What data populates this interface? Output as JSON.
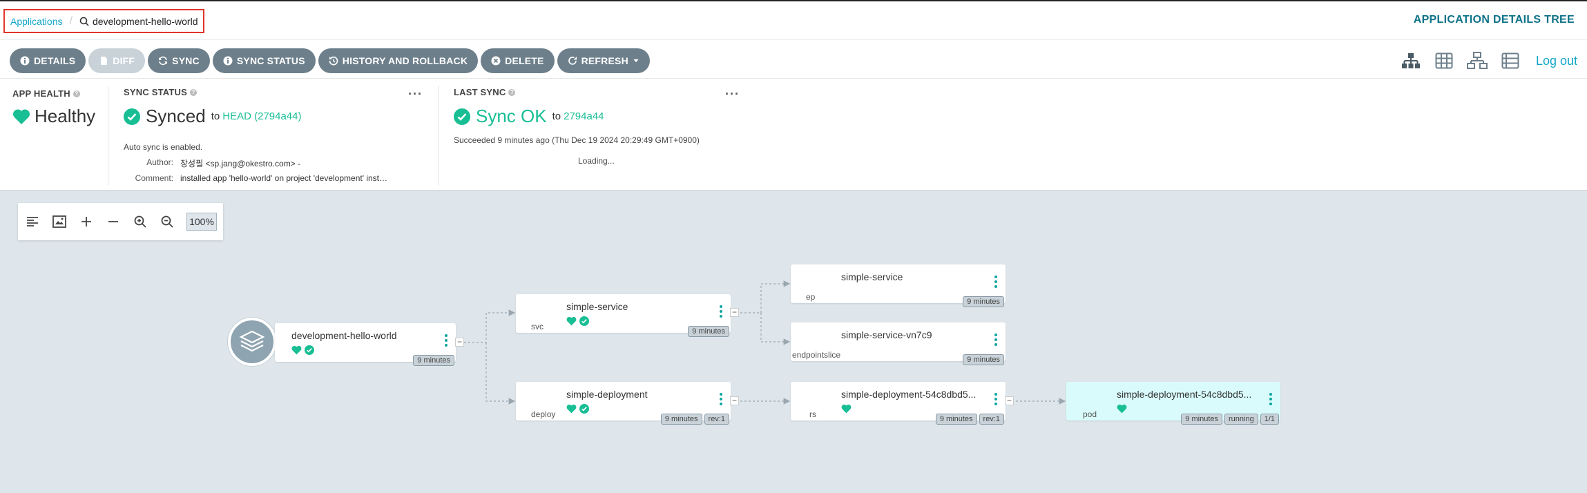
{
  "breadcrumb": {
    "root": "Applications",
    "current": "development-hello-world"
  },
  "page_title": "APPLICATION DETAILS TREE",
  "toolbar": {
    "details": "DETAILS",
    "diff": "DIFF",
    "sync": "SYNC",
    "sync_status": "SYNC STATUS",
    "history": "HISTORY AND ROLLBACK",
    "delete": "DELETE",
    "refresh": "REFRESH",
    "logout": "Log out",
    "view_icons": [
      "tree-view-icon",
      "pods-grid-view-icon",
      "network-view-icon",
      "list-view-icon"
    ]
  },
  "status": {
    "health": {
      "title": "APP HEALTH",
      "value": "Healthy"
    },
    "sync": {
      "title": "SYNC STATUS",
      "value": "Synced",
      "to_label": "to",
      "revision": "HEAD (2794a44)",
      "note": "Auto sync is enabled.",
      "author_label": "Author:",
      "author": "장성필 <sp.jang@okestro.com> -",
      "comment_label": "Comment:",
      "comment": "installed app 'hello-world' on project 'development' installatio"
    },
    "last_sync": {
      "title": "LAST SYNC",
      "value": "Sync OK",
      "to_label": "to",
      "revision": "2794a44",
      "note": "Succeeded 9 minutes ago (Thu Dec 19 2024 20:29:49 GMT+0900)",
      "loading": "Loading..."
    },
    "more": "···"
  },
  "zoom": {
    "value": "100%"
  },
  "colors": {
    "accent": "#12a6c8",
    "healthy": "#18be94",
    "button": "#6d7f8b",
    "title": "#0c7287"
  },
  "nodes": {
    "app": {
      "name": "development-hello-world",
      "age": "9 minutes"
    },
    "svc": {
      "name": "simple-service",
      "kind": "svc",
      "age": "9 minutes"
    },
    "deploy": {
      "name": "simple-deployment",
      "kind": "deploy",
      "age": "9 minutes",
      "rev": "rev:1"
    },
    "ep": {
      "name": "simple-service",
      "kind": "ep",
      "age": "9 minutes"
    },
    "endpointslice": {
      "name": "simple-service-vn7c9",
      "kind": "endpointslice",
      "age": "9 minutes"
    },
    "rs": {
      "name": "simple-deployment-54c8dbd5...",
      "kind": "rs",
      "age": "9 minutes",
      "rev": "rev:1"
    },
    "pod": {
      "name": "simple-deployment-54c8dbd5...",
      "kind": "pod",
      "age": "9 minutes",
      "state": "running",
      "ready": "1/1"
    }
  },
  "collapse_symbol": "−"
}
